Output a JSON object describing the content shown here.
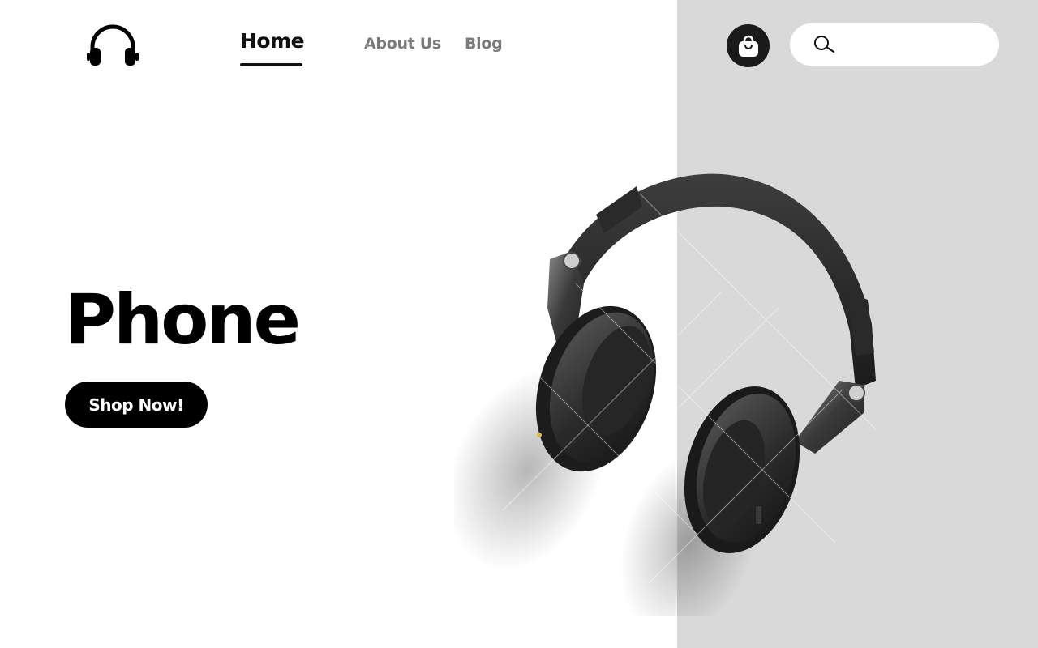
{
  "nav": {
    "home": "Home",
    "about": "About Us",
    "blog": "Blog"
  },
  "search": {
    "placeholder": "",
    "value": ""
  },
  "hero": {
    "title": "Phone",
    "cta_label": "Shop Now!"
  },
  "icons": {
    "logo": "headphones-icon",
    "cart": "shopping-bag-icon",
    "search": "search-icon"
  },
  "colors": {
    "background": "#ffffff",
    "panel": "#d9d9d9",
    "primary": "#000000",
    "nav_muted": "#7a7a7a",
    "button_text": "#ffffff"
  }
}
